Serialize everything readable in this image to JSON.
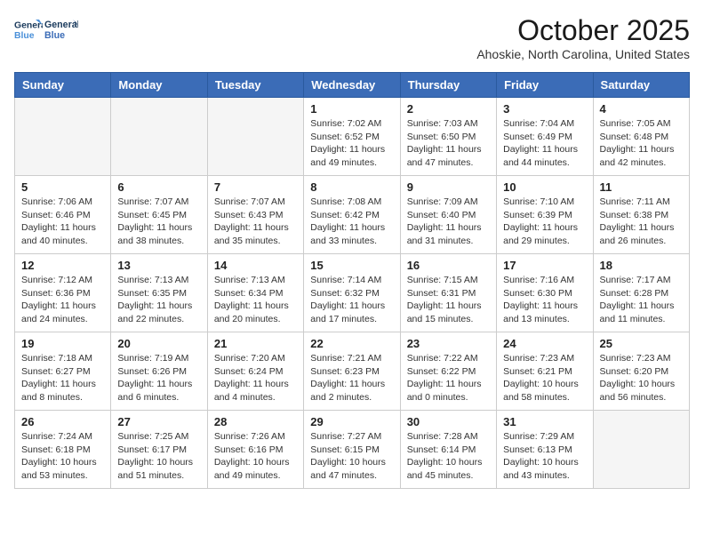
{
  "logo": {
    "line1": "General",
    "line2": "Blue"
  },
  "title": "October 2025",
  "subtitle": "Ahoskie, North Carolina, United States",
  "days_of_week": [
    "Sunday",
    "Monday",
    "Tuesday",
    "Wednesday",
    "Thursday",
    "Friday",
    "Saturday"
  ],
  "weeks": [
    [
      {
        "day": "",
        "info": ""
      },
      {
        "day": "",
        "info": ""
      },
      {
        "day": "",
        "info": ""
      },
      {
        "day": "1",
        "info": "Sunrise: 7:02 AM\nSunset: 6:52 PM\nDaylight: 11 hours\nand 49 minutes."
      },
      {
        "day": "2",
        "info": "Sunrise: 7:03 AM\nSunset: 6:50 PM\nDaylight: 11 hours\nand 47 minutes."
      },
      {
        "day": "3",
        "info": "Sunrise: 7:04 AM\nSunset: 6:49 PM\nDaylight: 11 hours\nand 44 minutes."
      },
      {
        "day": "4",
        "info": "Sunrise: 7:05 AM\nSunset: 6:48 PM\nDaylight: 11 hours\nand 42 minutes."
      }
    ],
    [
      {
        "day": "5",
        "info": "Sunrise: 7:06 AM\nSunset: 6:46 PM\nDaylight: 11 hours\nand 40 minutes."
      },
      {
        "day": "6",
        "info": "Sunrise: 7:07 AM\nSunset: 6:45 PM\nDaylight: 11 hours\nand 38 minutes."
      },
      {
        "day": "7",
        "info": "Sunrise: 7:07 AM\nSunset: 6:43 PM\nDaylight: 11 hours\nand 35 minutes."
      },
      {
        "day": "8",
        "info": "Sunrise: 7:08 AM\nSunset: 6:42 PM\nDaylight: 11 hours\nand 33 minutes."
      },
      {
        "day": "9",
        "info": "Sunrise: 7:09 AM\nSunset: 6:40 PM\nDaylight: 11 hours\nand 31 minutes."
      },
      {
        "day": "10",
        "info": "Sunrise: 7:10 AM\nSunset: 6:39 PM\nDaylight: 11 hours\nand 29 minutes."
      },
      {
        "day": "11",
        "info": "Sunrise: 7:11 AM\nSunset: 6:38 PM\nDaylight: 11 hours\nand 26 minutes."
      }
    ],
    [
      {
        "day": "12",
        "info": "Sunrise: 7:12 AM\nSunset: 6:36 PM\nDaylight: 11 hours\nand 24 minutes."
      },
      {
        "day": "13",
        "info": "Sunrise: 7:13 AM\nSunset: 6:35 PM\nDaylight: 11 hours\nand 22 minutes."
      },
      {
        "day": "14",
        "info": "Sunrise: 7:13 AM\nSunset: 6:34 PM\nDaylight: 11 hours\nand 20 minutes."
      },
      {
        "day": "15",
        "info": "Sunrise: 7:14 AM\nSunset: 6:32 PM\nDaylight: 11 hours\nand 17 minutes."
      },
      {
        "day": "16",
        "info": "Sunrise: 7:15 AM\nSunset: 6:31 PM\nDaylight: 11 hours\nand 15 minutes."
      },
      {
        "day": "17",
        "info": "Sunrise: 7:16 AM\nSunset: 6:30 PM\nDaylight: 11 hours\nand 13 minutes."
      },
      {
        "day": "18",
        "info": "Sunrise: 7:17 AM\nSunset: 6:28 PM\nDaylight: 11 hours\nand 11 minutes."
      }
    ],
    [
      {
        "day": "19",
        "info": "Sunrise: 7:18 AM\nSunset: 6:27 PM\nDaylight: 11 hours\nand 8 minutes."
      },
      {
        "day": "20",
        "info": "Sunrise: 7:19 AM\nSunset: 6:26 PM\nDaylight: 11 hours\nand 6 minutes."
      },
      {
        "day": "21",
        "info": "Sunrise: 7:20 AM\nSunset: 6:24 PM\nDaylight: 11 hours\nand 4 minutes."
      },
      {
        "day": "22",
        "info": "Sunrise: 7:21 AM\nSunset: 6:23 PM\nDaylight: 11 hours\nand 2 minutes."
      },
      {
        "day": "23",
        "info": "Sunrise: 7:22 AM\nSunset: 6:22 PM\nDaylight: 11 hours\nand 0 minutes."
      },
      {
        "day": "24",
        "info": "Sunrise: 7:23 AM\nSunset: 6:21 PM\nDaylight: 10 hours\nand 58 minutes."
      },
      {
        "day": "25",
        "info": "Sunrise: 7:23 AM\nSunset: 6:20 PM\nDaylight: 10 hours\nand 56 minutes."
      }
    ],
    [
      {
        "day": "26",
        "info": "Sunrise: 7:24 AM\nSunset: 6:18 PM\nDaylight: 10 hours\nand 53 minutes."
      },
      {
        "day": "27",
        "info": "Sunrise: 7:25 AM\nSunset: 6:17 PM\nDaylight: 10 hours\nand 51 minutes."
      },
      {
        "day": "28",
        "info": "Sunrise: 7:26 AM\nSunset: 6:16 PM\nDaylight: 10 hours\nand 49 minutes."
      },
      {
        "day": "29",
        "info": "Sunrise: 7:27 AM\nSunset: 6:15 PM\nDaylight: 10 hours\nand 47 minutes."
      },
      {
        "day": "30",
        "info": "Sunrise: 7:28 AM\nSunset: 6:14 PM\nDaylight: 10 hours\nand 45 minutes."
      },
      {
        "day": "31",
        "info": "Sunrise: 7:29 AM\nSunset: 6:13 PM\nDaylight: 10 hours\nand 43 minutes."
      },
      {
        "day": "",
        "info": ""
      }
    ]
  ]
}
